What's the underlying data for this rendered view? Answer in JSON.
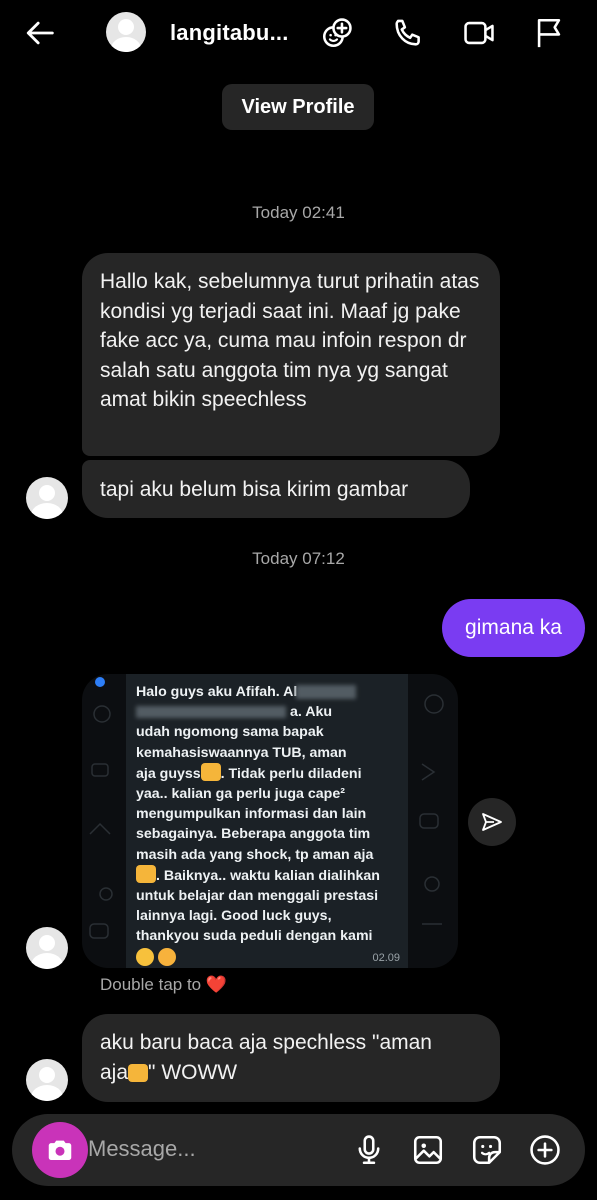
{
  "header": {
    "username": "langitabu...",
    "icons": [
      "back-arrow-icon",
      "add-people-icon",
      "phone-icon",
      "video-icon",
      "flag-icon"
    ]
  },
  "view_profile_label": "View Profile",
  "timestamps": [
    "Today 02:41",
    "Today 07:12"
  ],
  "messages": {
    "first": "Hallo kak, sebelumnya turut prihatin atas kondisi yg terjadi saat ini. Maaf jg pake fake acc ya, cuma mau infoin respon dr salah satu anggota tim nya yg sangat amat bikin speechless",
    "second": "tapi aku belum bisa kirim gambar",
    "mine": "gimana ka",
    "last_part1": "aku baru baca aja spechless \"aman",
    "last_part2": "aja",
    "last_part3": "\" WOWW"
  },
  "image_message": {
    "lines": [
      "Halo guys aku Afifah. Al",
      "a. Aku",
      "udah ngomong sama bapak",
      "kemahasiswaannya TUB, aman",
      "aja guyss",
      ". Tidak perlu diladeni",
      "yaa.. kalian ga perlu juga cape²",
      "mengumpulkan informasi dan lain",
      "sebagainya. Beberapa anggota tim",
      "masih ada yang shock, tp aman aja",
      ". Baiknya.. waktu kalian dialihkan",
      "untuk belajar dan menggali prestasi",
      "lainnya lagi. Good luck guys,",
      "thankyou suda peduli dengan kami"
    ],
    "time": "02.09"
  },
  "double_tap_hint": "Double tap to",
  "heart_emoji": "❤️",
  "composer": {
    "placeholder": "Message..."
  },
  "colors": {
    "background": "#000000",
    "bubble": "#262626",
    "my_bubble": "#7a3cf2",
    "camera_button": "#c933b9"
  }
}
